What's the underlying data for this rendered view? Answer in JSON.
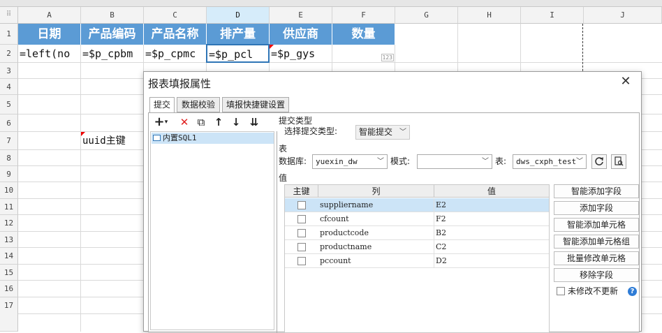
{
  "spreadsheet": {
    "columns": [
      "A",
      "B",
      "C",
      "D",
      "E",
      "F",
      "G",
      "H",
      "I",
      "J"
    ],
    "rows": [
      "1",
      "2",
      "3",
      "4",
      "5",
      "6",
      "7",
      "8",
      "9",
      "10",
      "11",
      "12",
      "13",
      "14",
      "15",
      "16",
      "17"
    ],
    "header_row": [
      "日期",
      "产品编码",
      "产品名称",
      "排产量",
      "供应商",
      "数量"
    ],
    "formula_row": [
      "=left(no",
      "=$p_cpbm",
      "=$p_cpmc",
      "=$p_pcl",
      "=$p_gys",
      ""
    ],
    "badge_f2": "123",
    "b7_text": "uuid主键",
    "header_color": "#5b9bd5",
    "selected_border_color": "#2e75b6"
  },
  "dialog": {
    "title": "报表填报属性",
    "close": "✕",
    "tabs": [
      "提交",
      "数据校验",
      "填报快捷键设置"
    ],
    "toolbar": {
      "add": "+",
      "add_caret": "▾",
      "delete": "✕",
      "copy": "⧉",
      "up": "↑",
      "down": "↓",
      "sort": "⇊"
    },
    "submit_list": [
      "内置SQL1"
    ],
    "submit_type_section": "提交类型",
    "submit_type_label": "选择提交类型:",
    "submit_type_value": "智能提交",
    "table_section": "表",
    "database_label": "数据库:",
    "database_value": "yuexin_dw",
    "mode_label": "模式:",
    "mode_value": "",
    "table_label": "表:",
    "table_value": "dws_cxph_test",
    "value_section": "值",
    "grid_headers": [
      "主键",
      "列",
      "值"
    ],
    "grid_rows": [
      {
        "col": "suppliername",
        "val": "E2"
      },
      {
        "col": "cfcount",
        "val": "F2"
      },
      {
        "col": "productcode",
        "val": "B2"
      },
      {
        "col": "productname",
        "val": "C2"
      },
      {
        "col": "pccount",
        "val": "D2"
      }
    ],
    "right_buttons": [
      "智能添加字段",
      "添加字段",
      "智能添加单元格",
      "智能添加单元格组",
      "批量修改单元格",
      "移除字段"
    ],
    "no_update_label": "未修改不更新",
    "help": "?",
    "dropdown_arrow": "﹀"
  }
}
